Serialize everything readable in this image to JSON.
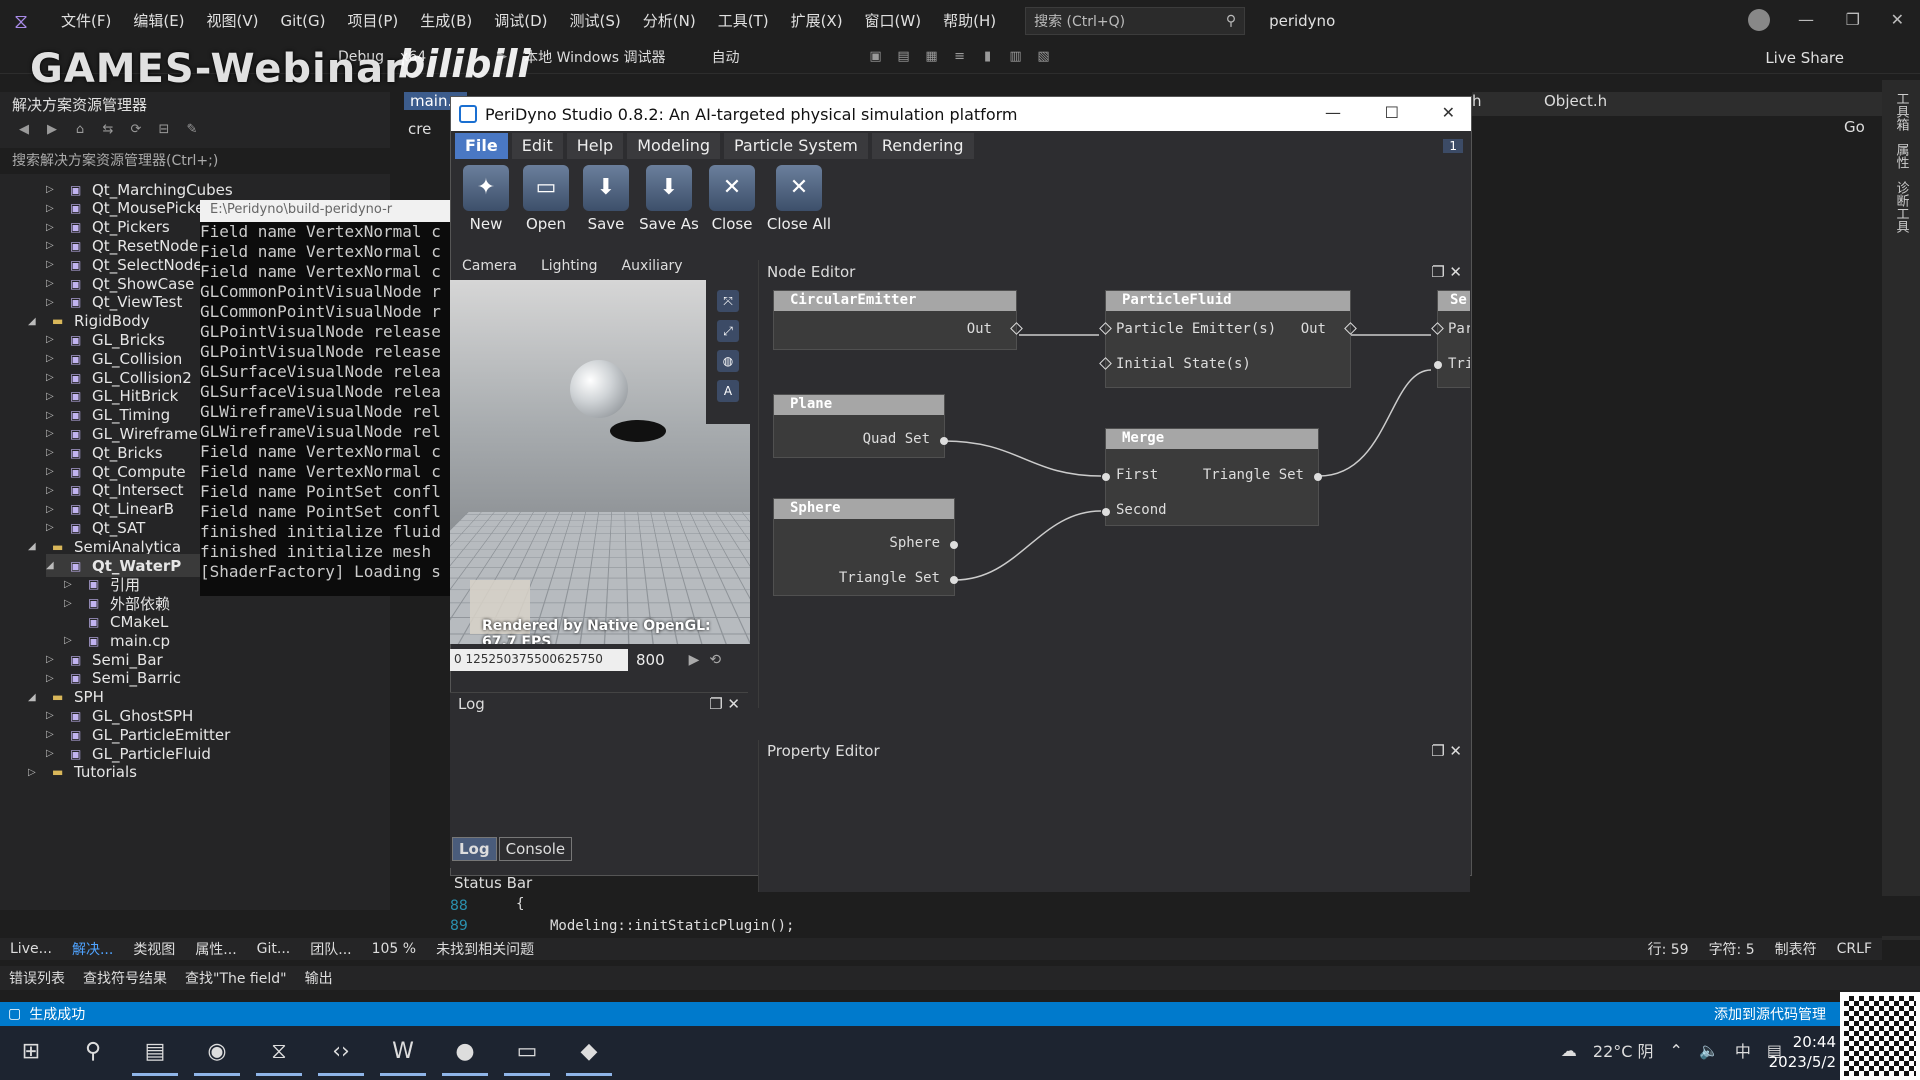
{
  "vs": {
    "menu": [
      "文件(F)",
      "编辑(E)",
      "视图(V)",
      "Git(G)",
      "项目(P)",
      "生成(B)",
      "调试(D)",
      "测试(S)",
      "分析(N)",
      "工具(T)",
      "扩展(X)",
      "窗口(W)",
      "帮助(H)"
    ],
    "search_placeholder": "搜索 (Ctrl+Q)",
    "project": "peridyno",
    "toolbar": {
      "config": "Debug",
      "platform": "x64",
      "debugger": "本地 Windows 调试器",
      "auto": "自动",
      "live_share": "Live Share"
    },
    "watermark": "GAMES-Webinar",
    "watermark_brand": "bilibili",
    "solution_explorer": {
      "title": "解决方案资源管理器",
      "search": "搜索解决方案资源管理器(Ctrl+;)",
      "items": [
        {
          "label": "Qt_MarchingCubes",
          "indent": 2
        },
        {
          "label": "Qt_MousePicker",
          "indent": 2
        },
        {
          "label": "Qt_Pickers",
          "indent": 2
        },
        {
          "label": "Qt_ResetNode",
          "indent": 2
        },
        {
          "label": "Qt_SelectNode",
          "indent": 2
        },
        {
          "label": "Qt_ShowCase",
          "indent": 2
        },
        {
          "label": "Qt_ViewTest",
          "indent": 2
        },
        {
          "label": "RigidBody",
          "indent": 1,
          "folder": true,
          "open": true
        },
        {
          "label": "GL_Bricks",
          "indent": 2
        },
        {
          "label": "GL_Collision",
          "indent": 2
        },
        {
          "label": "GL_Collision2",
          "indent": 2
        },
        {
          "label": "GL_HitBrick",
          "indent": 2
        },
        {
          "label": "GL_Timing",
          "indent": 2
        },
        {
          "label": "GL_Wireframe",
          "indent": 2
        },
        {
          "label": "Qt_Bricks",
          "indent": 2
        },
        {
          "label": "Qt_Compute",
          "indent": 2
        },
        {
          "label": "Qt_Intersect",
          "indent": 2
        },
        {
          "label": "Qt_LinearB",
          "indent": 2
        },
        {
          "label": "Qt_SAT",
          "indent": 2
        },
        {
          "label": "SemiAnalytica",
          "indent": 1,
          "folder": true,
          "open": true
        },
        {
          "label": "Qt_WaterP",
          "indent": 2,
          "selected": true,
          "open": true
        },
        {
          "label": "引用",
          "indent": 3
        },
        {
          "label": "外部依赖",
          "indent": 3
        },
        {
          "label": "CMakeL",
          "indent": 3,
          "leaf": true
        },
        {
          "label": "main.cp",
          "indent": 3
        },
        {
          "label": "Semi_Bar",
          "indent": 2
        },
        {
          "label": "Semi_Barric",
          "indent": 2
        },
        {
          "label": "SPH",
          "indent": 1,
          "folder": true,
          "open": true
        },
        {
          "label": "GL_GhostSPH",
          "indent": 2
        },
        {
          "label": "GL_ParticleEmitter",
          "indent": 2
        },
        {
          "label": "GL_ParticleFluid",
          "indent": 2
        },
        {
          "label": "Tutorials",
          "indent": 1,
          "folder": true
        }
      ]
    },
    "editor_tab_left": "main.c",
    "editor_cre": "cre",
    "right_tabs": [
      "h",
      "Object.h"
    ],
    "go": "Go",
    "side_strip": [
      "工具箱",
      "属性",
      "诊断工具"
    ],
    "code": {
      "lines": [
        {
          "num": "88",
          "text": "{"
        },
        {
          "num": "89",
          "text": "Modeling::initStaticPlugin();"
        }
      ]
    },
    "bottom_row1": [
      "Live...",
      "解决...",
      "类视图",
      "属性...",
      "Git...",
      "团队...",
      "105 %",
      "未找到相关问题",
      "行: 59",
      "字符: 5",
      "制表符",
      "CRLF"
    ],
    "bottom_row2": [
      "错误列表",
      "查找符号结果",
      "查找\"The field\"",
      "输出"
    ],
    "status": {
      "text": "生成成功",
      "right": "添加到源代码管理"
    }
  },
  "console": {
    "title": "E:\\Peridyno\\build-peridyno-r",
    "lines": [
      "Field name VertexNormal c",
      "Field name VertexNormal c",
      "Field name VertexNormal c",
      "GLCommonPointVisualNode r",
      "GLCommonPointVisualNode r",
      "GLPointVisualNode release",
      "GLPointVisualNode release",
      "GLSurfaceVisualNode relea",
      "GLSurfaceVisualNode relea",
      "GLWireframeVisualNode rel",
      "GLWireframeVisualNode rel",
      "Field name VertexNormal c",
      "Field name VertexNormal c",
      "Field name PointSet confl",
      "Field name PointSet confl",
      "finished initialize fluid",
      "finished initialize mesh",
      "[ShaderFactory] Loading s"
    ]
  },
  "peridyno": {
    "title": "PeriDyno Studio 0.8.2:  An AI-targeted physical simulation platform",
    "tabs": [
      "File",
      "Edit",
      "Help",
      "Modeling",
      "Particle System",
      "Rendering"
    ],
    "active_tab": "File",
    "tab_badge": "1",
    "ribbon": [
      {
        "label": "New",
        "icon": "new-icon"
      },
      {
        "label": "Open",
        "icon": "open-icon"
      },
      {
        "label": "Save",
        "icon": "save-icon"
      },
      {
        "label": "Save As",
        "icon": "save-as-icon"
      },
      {
        "label": "Close",
        "icon": "close-file-icon"
      },
      {
        "label": "Close All",
        "icon": "close-all-icon"
      }
    ],
    "viewport_tabs": [
      "Camera",
      "Lighting",
      "Auxiliary"
    ],
    "fps_text": "Rendered by Native OpenGL: 67.7 FPS",
    "timeline": {
      "ticks": "0 125250375500625750",
      "end": "800"
    },
    "log": {
      "title": "Log",
      "tabs": [
        "Log",
        "Console"
      ]
    },
    "status_bar": "Status Bar",
    "node_editor": {
      "title": "Node Editor",
      "nodes": {
        "emitter": {
          "name": "CircularEmitter",
          "out": "Out"
        },
        "fluid": {
          "name": "ParticleFluid",
          "in1": "Particle Emitter(s)",
          "in2": "Initial State(s)",
          "out": "Out"
        },
        "third": {
          "name": "Se",
          "in1": "Par",
          "in2": "Tri"
        },
        "plane": {
          "name": "Plane",
          "out": "Quad Set"
        },
        "merge": {
          "name": "Merge",
          "in1": "First",
          "in2": "Second",
          "out": "Triangle Set"
        },
        "sphere": {
          "name": "Sphere",
          "out1": "Sphere",
          "out2": "Triangle Set"
        }
      }
    },
    "property_editor": {
      "title": "Property Editor"
    }
  },
  "taskbar": {
    "weather": "22°C 阴",
    "ime": "中",
    "time": "20:44",
    "date": "2023/5/2"
  }
}
